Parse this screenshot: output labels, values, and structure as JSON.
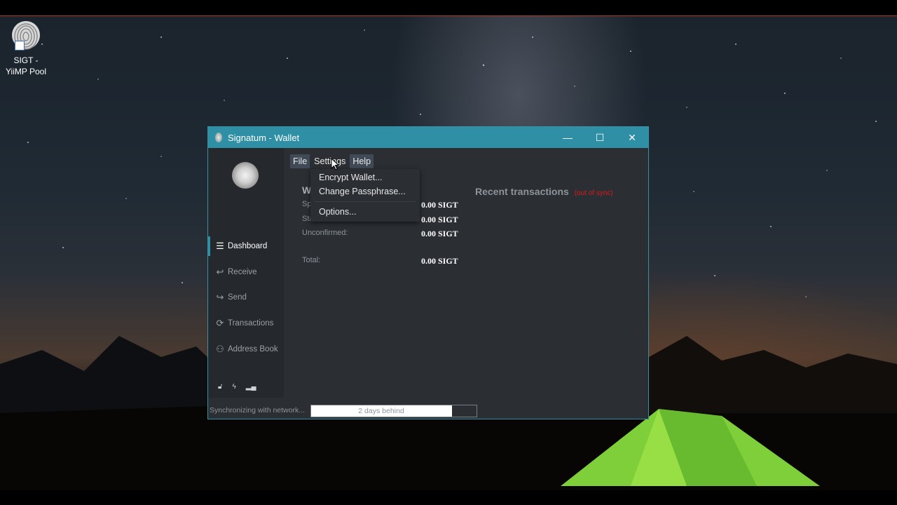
{
  "desktop": {
    "icon_label": "SIGT - YiiMP Pool"
  },
  "window": {
    "title": "Signatum - Wallet",
    "controls": {
      "minimize": "—",
      "maximize": "☐",
      "close": "✕"
    }
  },
  "menubar": {
    "items": [
      "File",
      "Settings",
      "Help"
    ],
    "open_menu": "Settings"
  },
  "settings_menu": {
    "items": [
      "Encrypt Wallet...",
      "Change Passphrase...",
      "Options..."
    ]
  },
  "sidebar": {
    "items": [
      {
        "label": "Dashboard",
        "icon": "dashboard-icon",
        "active": true
      },
      {
        "label": "Receive",
        "icon": "receive-icon",
        "active": false
      },
      {
        "label": "Send",
        "icon": "send-icon",
        "active": false
      },
      {
        "label": "Transactions",
        "icon": "transactions-icon",
        "active": false
      },
      {
        "label": "Address Book",
        "icon": "address-book-icon",
        "active": false
      }
    ]
  },
  "balances": {
    "heading_partial": "W",
    "spendable_label_partial": "Sp",
    "spendable": "0.00 SIGT",
    "stake_label": "Stake:",
    "stake": "0.00 SIGT",
    "unconfirmed_label": "Unconfirmed:",
    "unconfirmed": "0.00 SIGT",
    "total_label": "Total:",
    "total": "0.00 SIGT"
  },
  "recent": {
    "title": "Recent transactions",
    "sync_status": "(out of sync)"
  },
  "statusbar": {
    "text": "Synchronizing with network...",
    "progress_label": "2 days behind",
    "progress_fraction": 0.85
  },
  "colors": {
    "titlebar": "#2f8fa4",
    "window_bg": "#2b2e33",
    "sidebar_bg": "#25282c",
    "out_of_sync": "#d81c1c"
  }
}
